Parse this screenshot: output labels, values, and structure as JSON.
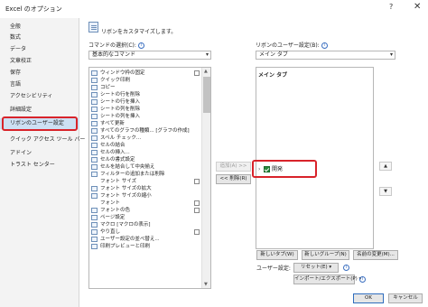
{
  "window": {
    "title": "Excel のオプション",
    "help": "?",
    "close": "✕"
  },
  "sidebar": {
    "items": [
      {
        "label": "全般"
      },
      {
        "label": "数式"
      },
      {
        "label": "データ"
      },
      {
        "label": "文章校正"
      },
      {
        "label": "保存"
      },
      {
        "label": "言語"
      },
      {
        "label": "アクセシビリティ"
      },
      {
        "label": "詳細設定"
      },
      {
        "label": "リボンのユーザー設定"
      },
      {
        "label": "クイック アクセス ツール バー"
      },
      {
        "label": "アドイン"
      },
      {
        "label": "トラスト センター"
      }
    ],
    "active_index": 8
  },
  "header": {
    "description": "リボンをカスタマイズします。"
  },
  "left": {
    "label": "コマンドの選択(C):",
    "select_value": "基本的なコマンド",
    "commands": [
      "ウィンドウ枠の固定",
      "クイック印刷",
      "コピー",
      "シートの行を削除",
      "シートの行を挿入",
      "シートの列を削除",
      "シートの列を挿入",
      "すべて更新",
      "すべてのグラフの種類... [グラフの作成]",
      "スペル チェック...",
      "セルの結合",
      "セルの挿入...",
      "セルの書式設定",
      "セルを結合して中央揃え",
      "フィルターの追加または削除",
      "フォント サイズ",
      "フォント サイズの拡大",
      "フォント サイズの縮小",
      "フォント",
      "フォントの色",
      "ページ設定",
      "マクロ [マクロの表示]",
      "やり直し",
      "ユーザー設定の並べ替え...",
      "印刷プレビューと印刷"
    ]
  },
  "middle": {
    "add_label": "追加(A) >>",
    "remove_label": "<< 削除(R)"
  },
  "right": {
    "label": "リボンのユーザー設定(B):",
    "select_value": "メイン タブ",
    "tree_header": "メイン タブ",
    "checked_tab": "開発",
    "up": "▲",
    "down": "▼"
  },
  "bottom": {
    "new_tab": "新しいタブ(W)",
    "new_group": "新しいグループ(N)",
    "rename": "名前の変更(M)...",
    "user_settings_label": "ユーザー設定:",
    "reset": "リセット(E) ▾",
    "import_export": "インポート/エクスポート(P) ▾",
    "ok": "OK",
    "cancel": "キャンセル"
  },
  "colors": {
    "highlight": "#d8232a",
    "active_sidebar": "#cde0f3",
    "check_green": "#2a8a3e"
  }
}
